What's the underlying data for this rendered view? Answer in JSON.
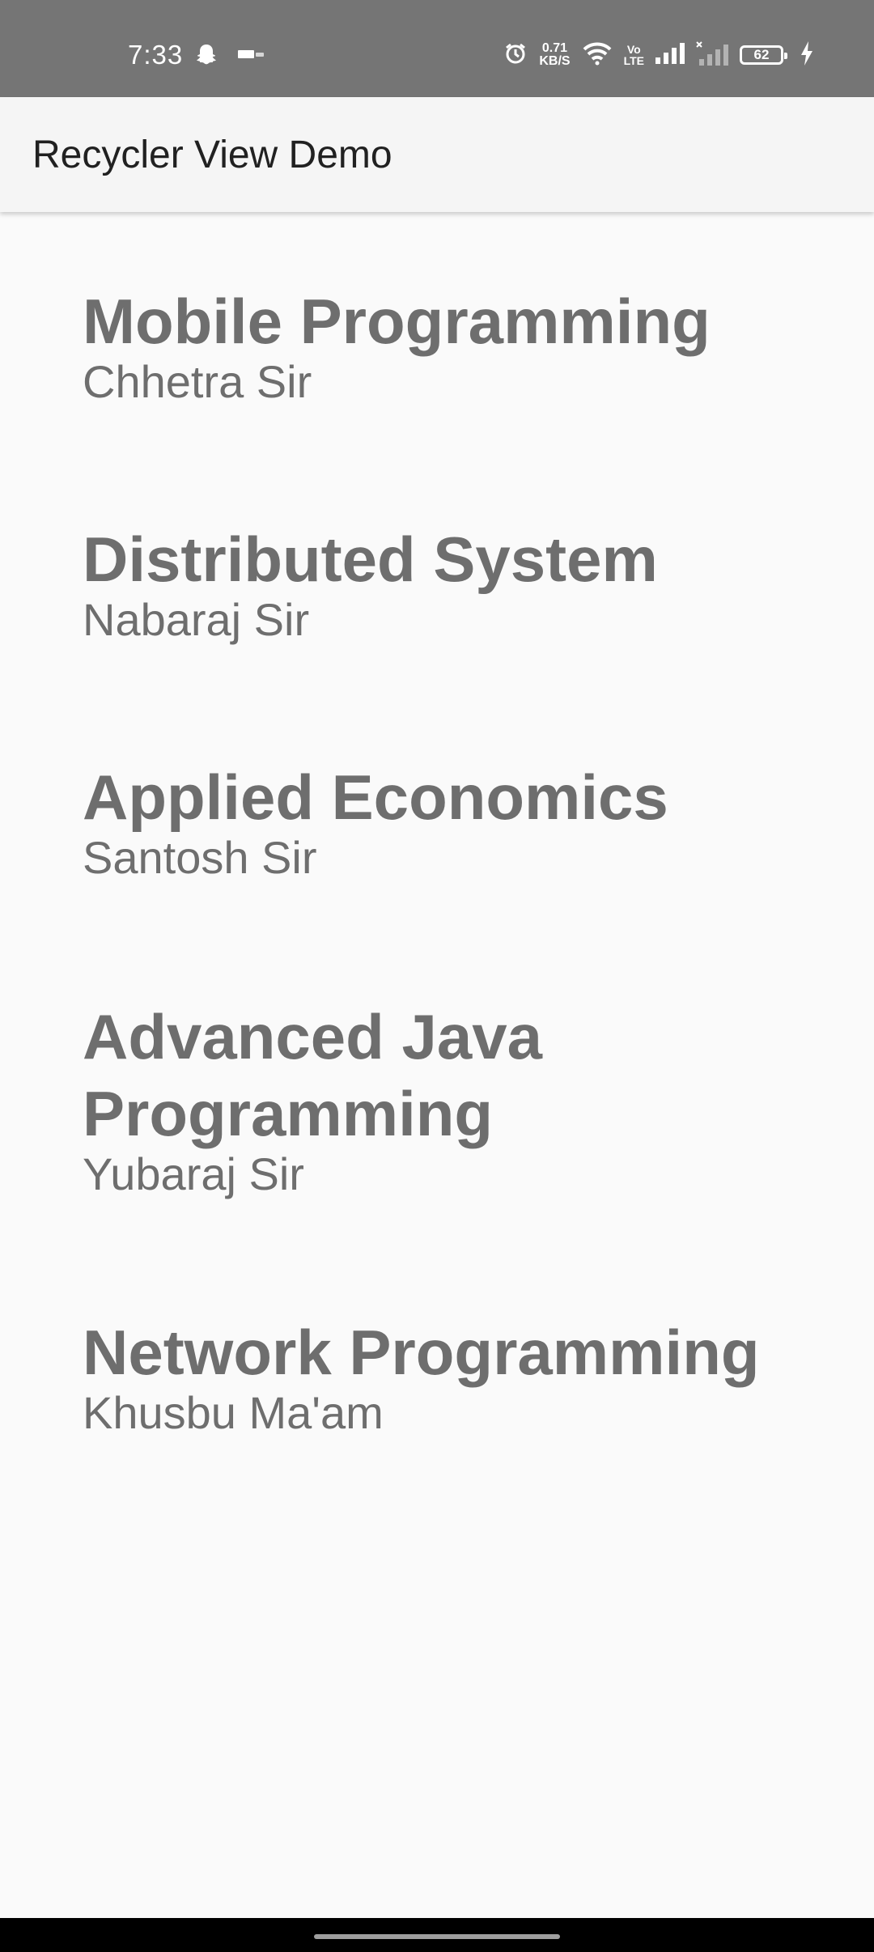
{
  "status_bar": {
    "time": "7:33",
    "icons_left": [
      "snapchat-icon",
      "notification-icon"
    ],
    "net_speed_value": "0.71",
    "net_speed_unit": "KB/S",
    "volte_top": "Vo",
    "volte_bottom": "LTE",
    "battery_level": "62",
    "icons_right": [
      "alarm-icon",
      "wifi-icon",
      "signal-icon",
      "signal-off-icon",
      "battery-icon",
      "charging-icon"
    ],
    "background": "#757575"
  },
  "app_bar": {
    "title": "Recycler View Demo",
    "background": "#f5f5f5"
  },
  "list": {
    "items": [
      {
        "title": "Mobile Programming",
        "subtitle": "Chhetra Sir"
      },
      {
        "title": "Distributed System",
        "subtitle": "Nabaraj Sir"
      },
      {
        "title": "Applied Economics",
        "subtitle": "Santosh Sir"
      },
      {
        "title": "Advanced Java Programming",
        "subtitle": "Yubaraj Sir"
      },
      {
        "title": "Network Programming",
        "subtitle": "Khusbu Ma'am"
      }
    ],
    "text_color": "#6e6e6e"
  }
}
